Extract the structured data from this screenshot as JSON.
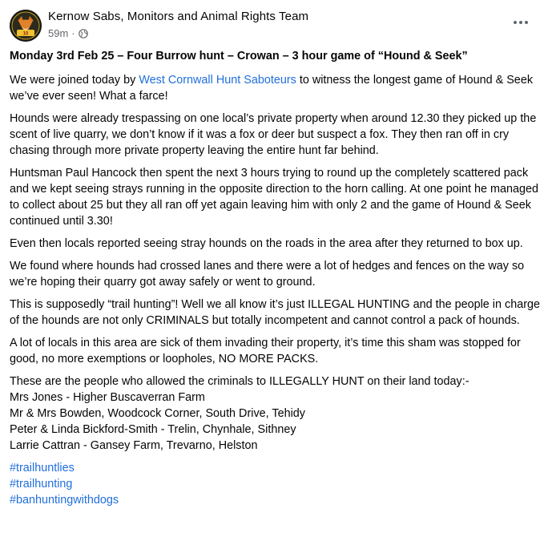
{
  "post": {
    "page_name": "Kernow Sabs, Monitors and Animal Rights Team",
    "time": "59m",
    "separator": "·",
    "title": "Monday 3rd Feb 25 – Four Burrow hunt – Crowan – 3 hour game of “Hound & Seek”",
    "p1_before": "We were joined today by ",
    "p1_link": "West Cornwall Hunt Saboteurs",
    "p1_after": " to witness the longest game of Hound & Seek we’ve ever seen! What a farce!",
    "p2": "Hounds were already trespassing on one local’s private property when around 12.30 they picked up the scent of live quarry, we don’t know if it was a fox or deer but suspect a fox. They then ran off in cry chasing through more private property leaving the entire hunt far behind.",
    "p3": "Huntsman Paul Hancock then spent the next 3 hours trying to round up the completely scattered pack and we kept seeing strays running in the opposite direction to the horn calling. At one point he managed to collect about 25 but they all ran off yet again leaving him with only 2 and the game of Hound & Seek continued until 3.30!",
    "p4": "Even then locals reported seeing stray hounds on the roads in the area after they returned to box up.",
    "p5": "We found where hounds had crossed lanes and there were a lot of hedges and fences on the way so we’re hoping their quarry got away safely or went to ground.",
    "p6": "This is supposedly “trail hunting”! Well we all know it’s just ILLEGAL HUNTING and the people in charge of the hounds are not only CRIMINALS but totally incompetent and cannot control a pack of hounds.",
    "p7": "A lot of locals in this area are sick of them invading their property, it’s time this sham was stopped for good, no more exemptions or loopholes, NO MORE PACKS.",
    "p8_intro": "These are the people who allowed the criminals to ILLEGALLY HUNT on their land today:-",
    "landowners": [
      "Mrs Jones - Higher Buscaverran Farm",
      "Mr & Mrs Bowden, Woodcock Corner, South Drive, Tehidy",
      "Peter & Linda Bickford-Smith - Trelin, Chynhale, Sithney",
      "Larrie Cattran - Gansey Farm, Trevarno, Helston"
    ],
    "hashtags": [
      "#trailhuntlies",
      "#trailhunting",
      "#banhuntingwithdogs"
    ]
  },
  "icons": {
    "avatar": "fox-logo-avatar",
    "privacy": "globe-icon",
    "menu": "more-options-icon"
  },
  "colors": {
    "link": "#216fdb",
    "meta_text": "#65676b",
    "body_text": "#050505"
  }
}
